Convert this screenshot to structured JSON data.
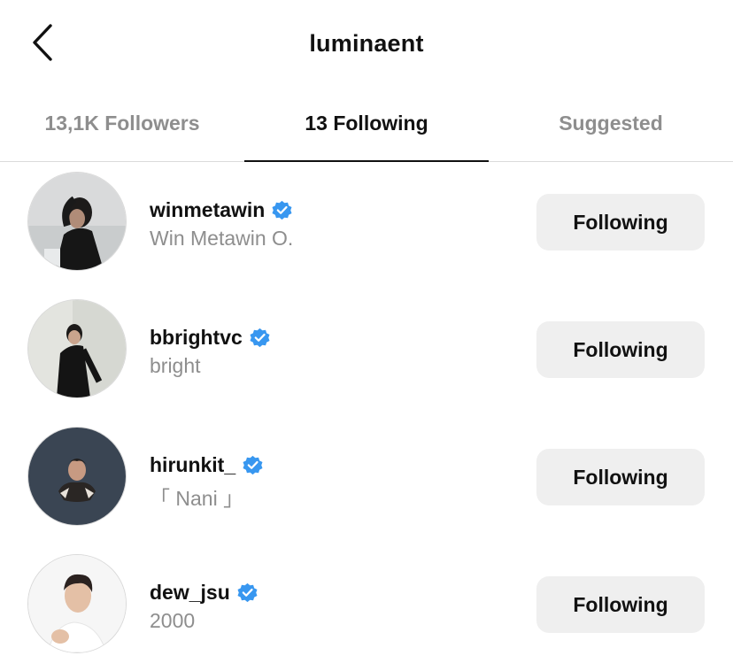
{
  "header": {
    "title": "luminaent",
    "back_icon": "chevron-left-icon"
  },
  "tabs": [
    {
      "label": "13,1K Followers",
      "active": false
    },
    {
      "label": "13 Following",
      "active": true
    },
    {
      "label": "Suggested",
      "active": false
    }
  ],
  "accounts": [
    {
      "username": "winmetawin",
      "full_name": "Win Metawin O.",
      "verified": true,
      "button_label": "Following"
    },
    {
      "username": "bbrightvc",
      "full_name": "bright",
      "verified": true,
      "button_label": "Following"
    },
    {
      "username": "hirunkit_",
      "full_name": "「 Nani 」",
      "verified": true,
      "button_label": "Following"
    },
    {
      "username": "dew_jsu",
      "full_name": "2000",
      "verified": true,
      "button_label": "Following"
    }
  ],
  "colors": {
    "verified_badge": "#3897f0",
    "secondary_text": "#8e8e8e",
    "button_bg": "#efefef"
  }
}
